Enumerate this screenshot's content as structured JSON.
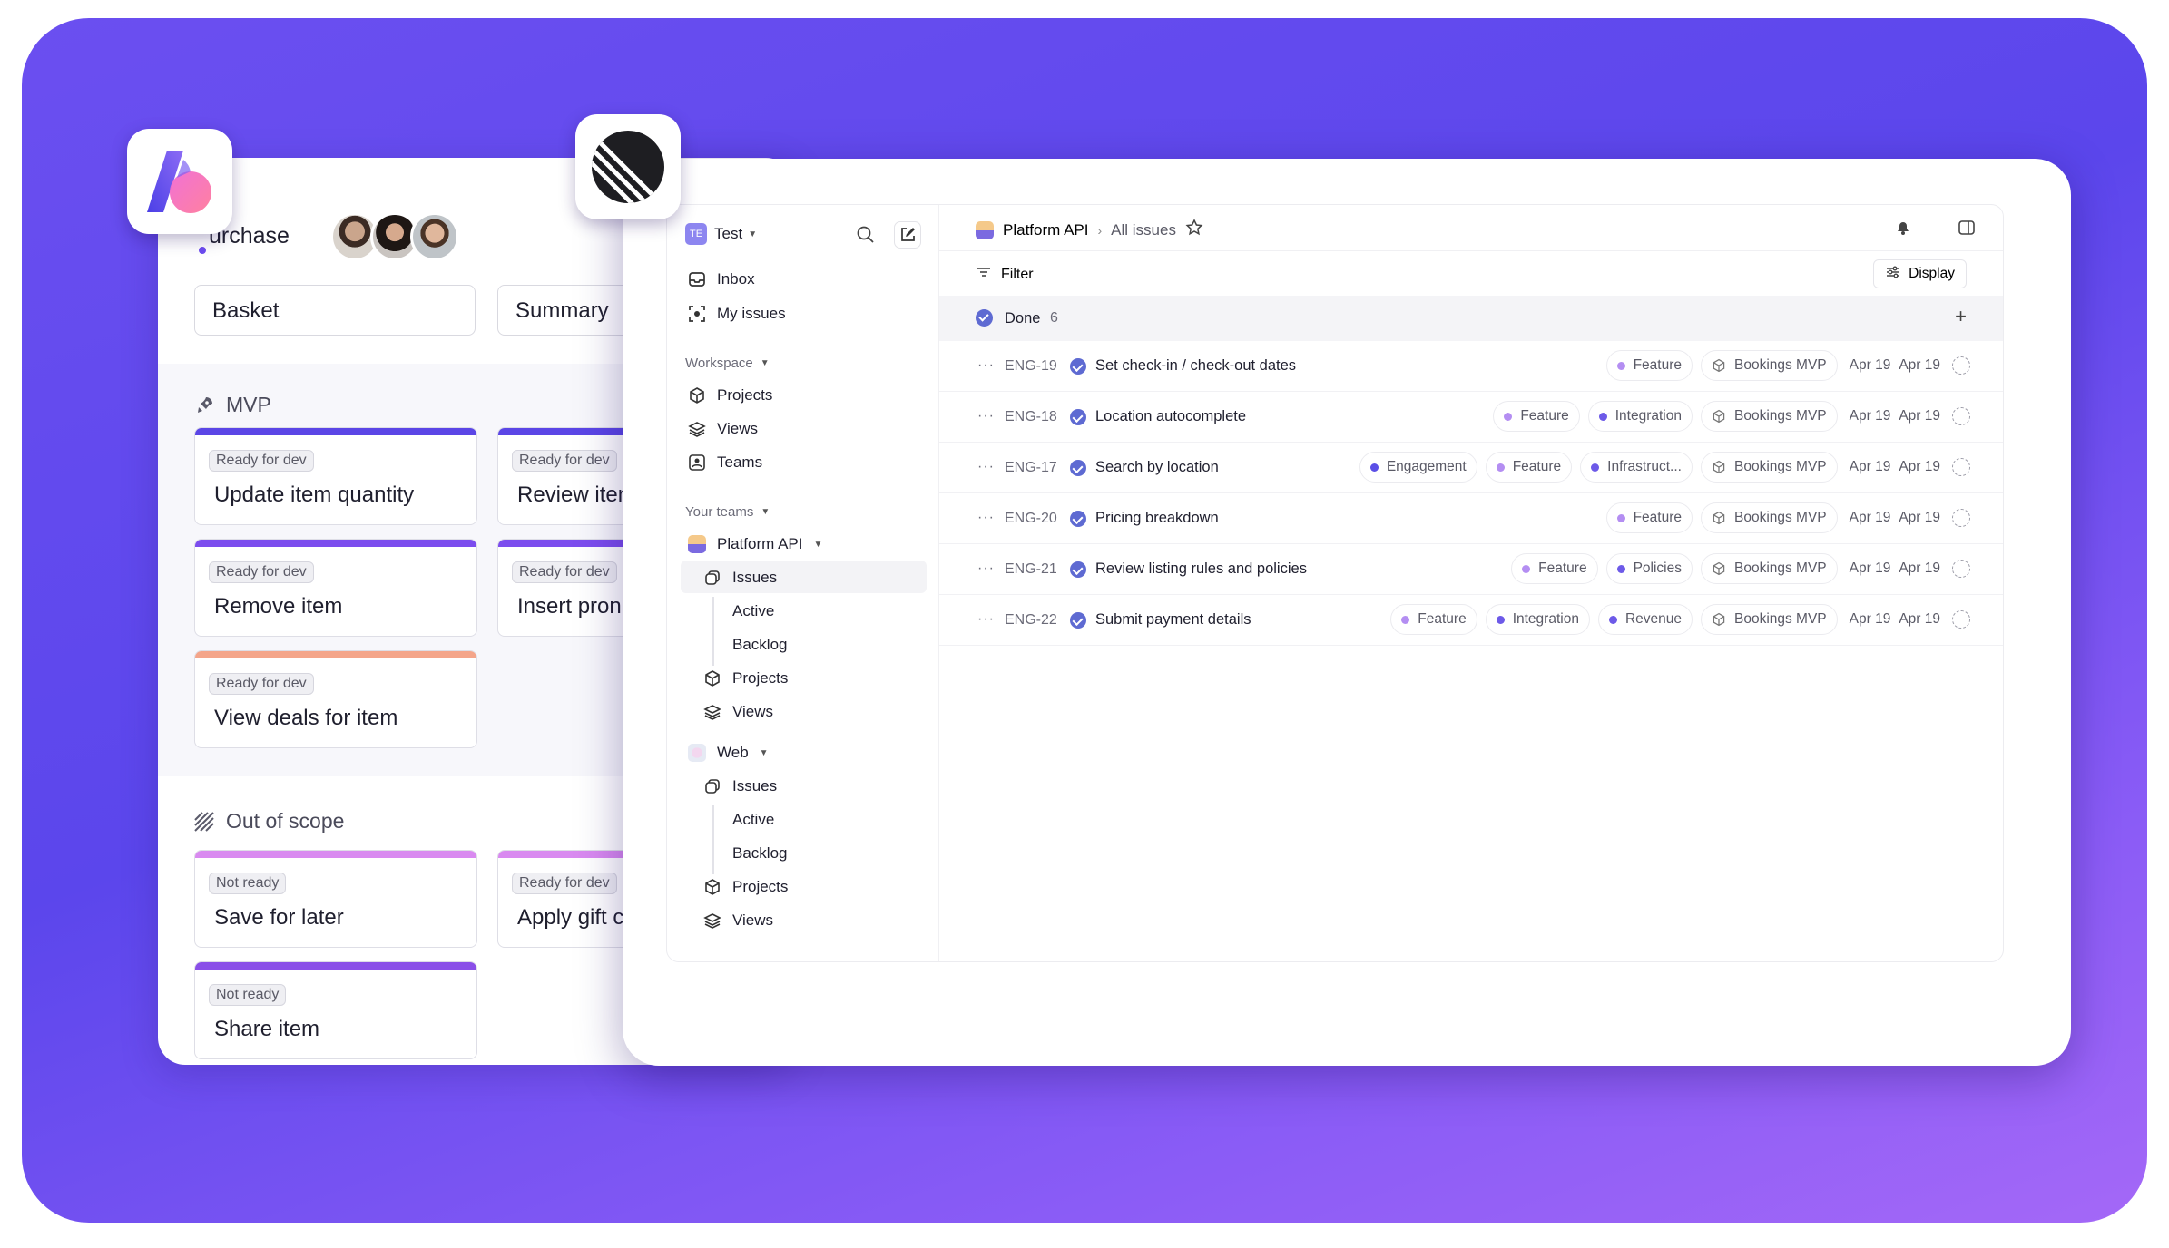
{
  "back_app": {
    "title": "urchase",
    "tabs": [
      "Basket",
      "Summary"
    ],
    "sections": [
      {
        "name": "MVP",
        "icon": "rocket-icon"
      },
      {
        "name": "Out of scope",
        "icon": "hatch-icon"
      }
    ],
    "cards": [
      {
        "badge": "Ready for dev",
        "title": "Update item quantity",
        "color": "#5b46e6"
      },
      {
        "badge": "Ready for dev",
        "title": "Review iten",
        "color": "#5b46e6"
      },
      {
        "badge": "Ready for dev",
        "title": "Remove item",
        "color": "#7c4dee"
      },
      {
        "badge": "Ready for dev",
        "title": "Insert pron",
        "color": "#7c4dee"
      },
      {
        "badge": "Ready for dev",
        "title": "View deals for item",
        "color": "#f4a58a"
      },
      {
        "badge": "Not ready",
        "title": "Save for later",
        "color": "#d98af0"
      },
      {
        "badge": "Ready for dev",
        "title": "Apply gift c",
        "color": "#d98af0"
      },
      {
        "badge": "Not ready",
        "title": "Share item",
        "color": "#8a4fe8"
      }
    ]
  },
  "linear": {
    "workspace": {
      "badge": "TE",
      "name": "Test"
    },
    "nav": {
      "inbox": "Inbox",
      "my_issues": "My issues"
    },
    "workspace_group": "Workspace",
    "workspace_items": [
      "Projects",
      "Views",
      "Teams"
    ],
    "your_teams": "Your teams",
    "teams": [
      {
        "name": "Platform API",
        "items": [
          "Issues",
          "Active",
          "Backlog",
          "Projects",
          "Views"
        ]
      },
      {
        "name": "Web",
        "items": [
          "Issues",
          "Active",
          "Backlog",
          "Projects",
          "Views"
        ]
      }
    ],
    "breadcrumb": {
      "team": "Platform API",
      "view": "All issues"
    },
    "filter_label": "Filter",
    "display_label": "Display",
    "group": {
      "label": "Done",
      "count": "6"
    },
    "issues": [
      {
        "id": "ENG-19",
        "title": "Set check-in / check-out dates",
        "labels": [
          {
            "name": "Feature",
            "color": "#b48ef2"
          }
        ],
        "project": "Bookings MVP",
        "start": "Apr 19",
        "due": "Apr 19"
      },
      {
        "id": "ENG-18",
        "title": "Location autocomplete",
        "labels": [
          {
            "name": "Feature",
            "color": "#b48ef2"
          },
          {
            "name": "Integration",
            "color": "#6d5ae8"
          }
        ],
        "project": "Bookings MVP",
        "start": "Apr 19",
        "due": "Apr 19"
      },
      {
        "id": "ENG-17",
        "title": "Search by location",
        "labels": [
          {
            "name": "Engagement",
            "color": "#5b4fe6"
          },
          {
            "name": "Feature",
            "color": "#b48ef2"
          },
          {
            "name": "Infrastruct...",
            "color": "#6d5ae8"
          }
        ],
        "project": "Bookings MVP",
        "start": "Apr 19",
        "due": "Apr 19"
      },
      {
        "id": "ENG-20",
        "title": "Pricing breakdown",
        "labels": [
          {
            "name": "Feature",
            "color": "#b48ef2"
          }
        ],
        "project": "Bookings MVP",
        "start": "Apr 19",
        "due": "Apr 19"
      },
      {
        "id": "ENG-21",
        "title": "Review listing rules and policies",
        "labels": [
          {
            "name": "Feature",
            "color": "#b48ef2"
          },
          {
            "name": "Policies",
            "color": "#6d5ae8"
          }
        ],
        "project": "Bookings MVP",
        "start": "Apr 19",
        "due": "Apr 19"
      },
      {
        "id": "ENG-22",
        "title": "Submit payment details",
        "labels": [
          {
            "name": "Feature",
            "color": "#b48ef2"
          },
          {
            "name": "Integration",
            "color": "#6d5ae8"
          },
          {
            "name": "Revenue",
            "color": "#6d5ae8"
          }
        ],
        "project": "Bookings MVP",
        "start": "Apr 19",
        "due": "Apr 19"
      }
    ]
  },
  "colors": {
    "accent": "#5e6ad2",
    "brand_purple": "#6b4ff0"
  }
}
